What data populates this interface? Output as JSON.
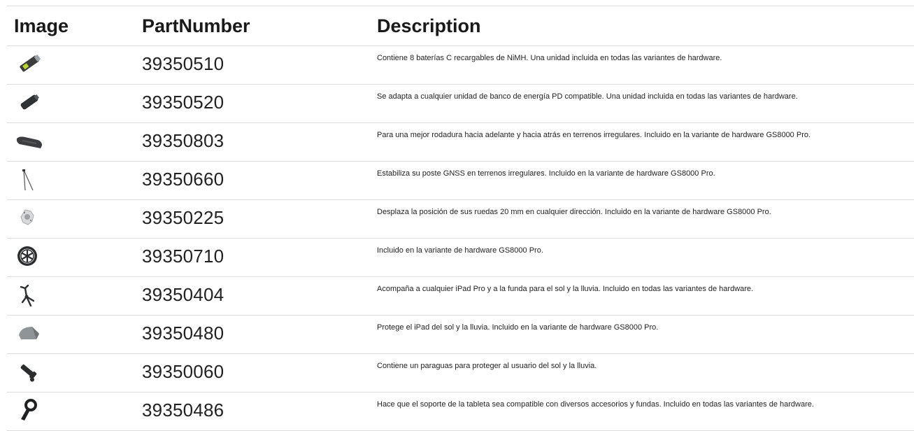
{
  "headers": {
    "image": "Image",
    "part_number": "PartNumber",
    "description": "Description"
  },
  "rows": [
    {
      "icon": "battery-pack-icon",
      "part_number": "39350510",
      "description": "Contiene 8 baterías C recargables de NiMH. Una unidad incluida en todas las variantes de hardware."
    },
    {
      "icon": "power-adapter-icon",
      "part_number": "39350520",
      "description": "Se adapta a cualquier unidad de banco de energía PD compatible. Una unidad incluida en todas las variantes de hardware."
    },
    {
      "icon": "skid-plate-icon",
      "part_number": "39350803",
      "description": "Para una mejor rodadura hacia adelante y hacia atrás en terrenos irregulares. Incluido en la variante de hardware GS8000 Pro."
    },
    {
      "icon": "bipod-icon",
      "part_number": "39350660",
      "description": "Estabiliza su poste GNSS en terrenos irregulares. Incluido en la variante de hardware GS8000 Pro."
    },
    {
      "icon": "wheel-offset-adapter-icon",
      "part_number": "39350225",
      "description": "Desplaza la posición de sus ruedas 20 mm en cualquier dirección. Incluido en la variante de hardware GS8000 Pro."
    },
    {
      "icon": "wheel-icon",
      "part_number": "39350710",
      "description": "Incluido en la variante de hardware GS8000 Pro."
    },
    {
      "icon": "tablet-mount-icon",
      "part_number": "39350404",
      "description": "Acompaña a cualquier iPad Pro y a la funda para el sol y la lluvia. Incluido en todas las variantes de hardware."
    },
    {
      "icon": "sun-rain-cover-icon",
      "part_number": "39350480",
      "description": "Protege el iPad del sol y la lluvia. Incluido en la variante de hardware GS8000 Pro."
    },
    {
      "icon": "umbrella-holder-icon",
      "part_number": "39350060",
      "description": "Contiene un paraguas para proteger al usuario del sol y la lluvia."
    },
    {
      "icon": "tablet-adapter-icon",
      "part_number": "39350486",
      "description": "Hace que el soporte de la tableta sea compatible con diversos accesorios y fundas. Incluido en todas las variantes de hardware."
    }
  ]
}
